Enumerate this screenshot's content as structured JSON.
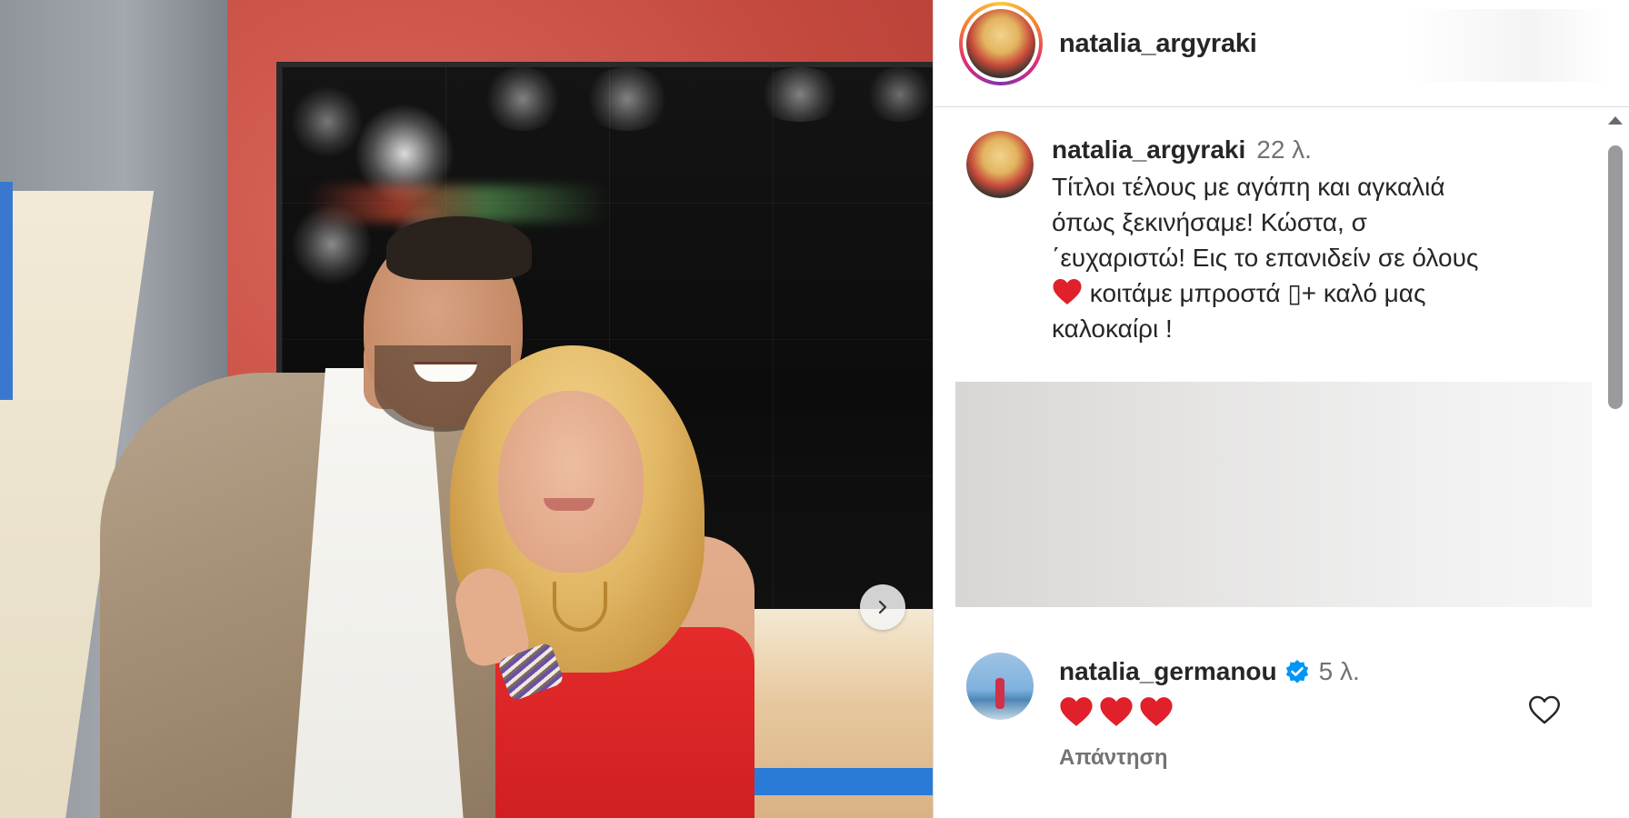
{
  "post": {
    "photo": {
      "next_icon": "chevron-right-icon"
    }
  },
  "header": {
    "username": "natalia_argyraki",
    "avatar_icon": "profile-avatar"
  },
  "caption": {
    "username": "natalia_argyraki",
    "time": "22 λ.",
    "line1": "Τίτλοι τέλους με αγάπη και αγκαλιά",
    "line2": "όπως ξεκινήσαμε! Κώστα, σ",
    "line3": "΄ευχαριστώ! Εις το επανιδείν σε όλους",
    "line4_after_heart": " κοιτάμε μπροστά ",
    "line4_glyph": "▯",
    "line4_end": "+ καλό μας",
    "line5": "καλοκαίρι !",
    "emoji": "red-heart-emoji"
  },
  "comment": {
    "username": "natalia_germanou",
    "verified_icon": "verified-badge-icon",
    "time": "5 λ.",
    "hearts": [
      "red-heart-emoji",
      "red-heart-emoji",
      "red-heart-emoji"
    ],
    "reply_label": "Απάντηση",
    "like_icon": "heart-outline-icon"
  },
  "colors": {
    "text_primary": "#262626",
    "text_secondary": "#737373",
    "verified_blue": "#0095f6",
    "heart_red": "#e0202a",
    "divider": "#dbdbdb"
  }
}
